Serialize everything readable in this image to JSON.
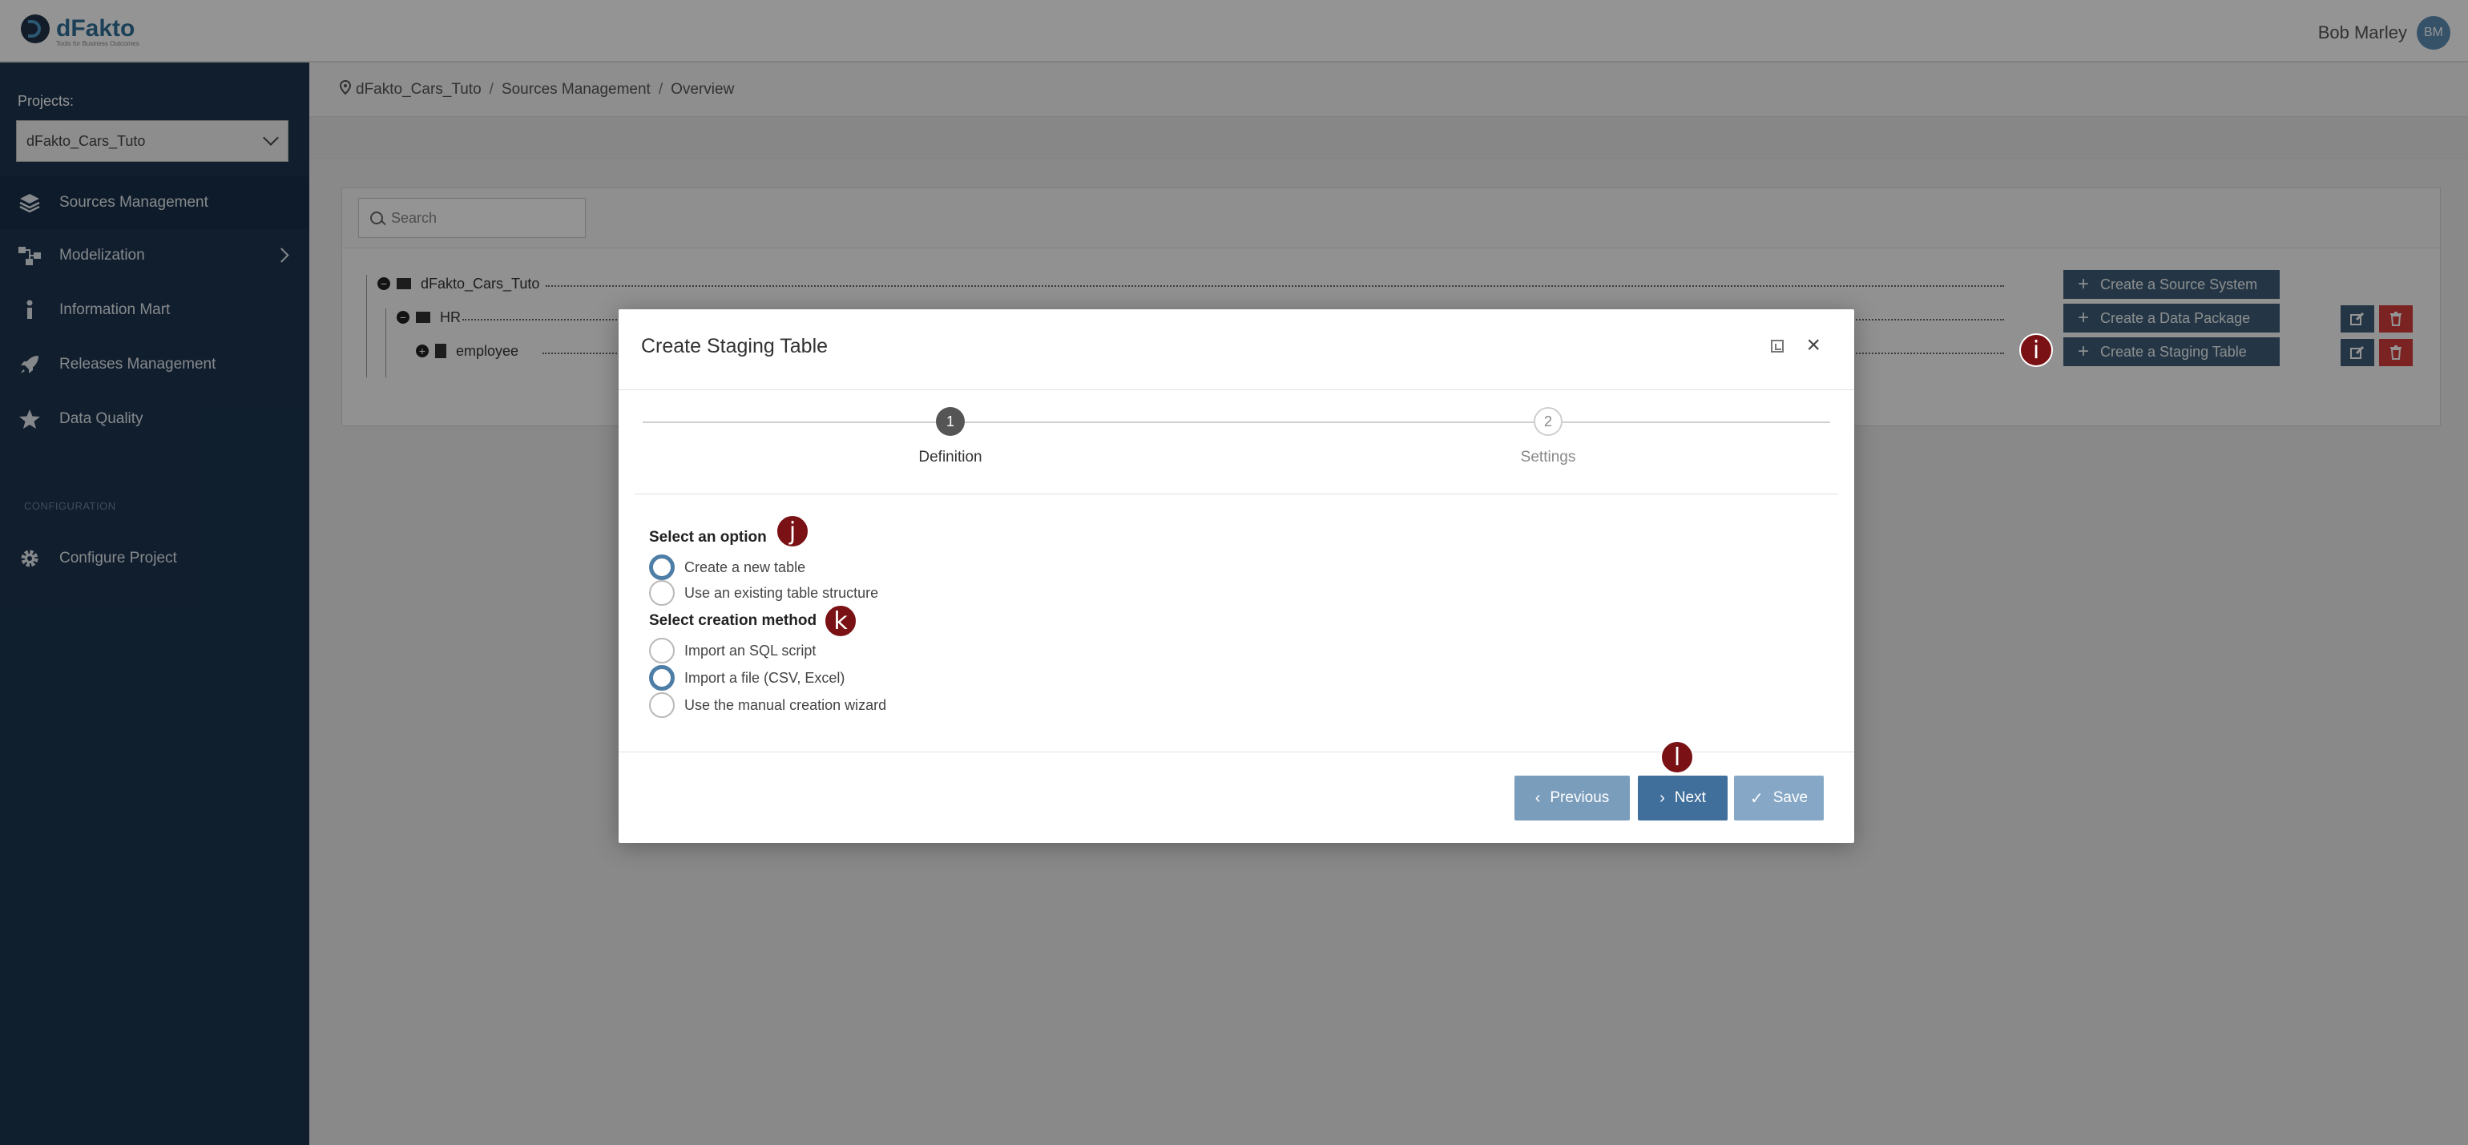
{
  "header": {
    "logo_text": "dFakto",
    "logo_tagline": "Tools for Business Outcomes",
    "user_name": "Bob Marley",
    "user_initials": "BM"
  },
  "sidebar": {
    "projects_label": "Projects:",
    "project_selected": "dFakto_Cars_Tuto",
    "items": [
      {
        "label": "Sources Management",
        "icon": "layers-icon"
      },
      {
        "label": "Modelization",
        "icon": "hierarchy-icon"
      },
      {
        "label": "Information Mart",
        "icon": "info-icon"
      },
      {
        "label": "Releases Management",
        "icon": "rocket-icon"
      },
      {
        "label": "Data Quality",
        "icon": "star-icon"
      }
    ],
    "section_label": "CONFIGURATION",
    "config_item": {
      "label": "Configure Project",
      "icon": "gear-icon"
    }
  },
  "breadcrumb": [
    "dFakto_Cars_Tuto",
    "Sources Management",
    "Overview"
  ],
  "search": {
    "placeholder": "Search"
  },
  "tree": [
    {
      "label": "dFakto_Cars_Tuto",
      "toggle": "−"
    },
    {
      "label": "HR",
      "toggle": "−"
    },
    {
      "label": "employee",
      "toggle": "+"
    }
  ],
  "actions": {
    "create_source_system": "Create a Source System",
    "create_data_package": "Create a Data Package",
    "create_staging_table": "Create a Staging Table"
  },
  "modal": {
    "title": "Create Staging Table",
    "steps": [
      {
        "number": "1",
        "label": "Definition"
      },
      {
        "number": "2",
        "label": "Settings"
      }
    ],
    "option_label": "Select an option",
    "options": [
      "Create a new table",
      "Use an existing table structure"
    ],
    "method_label": "Select creation method",
    "methods": [
      "Import an SQL script",
      "Import a file (CSV, Excel)",
      "Use the manual creation wizard"
    ],
    "buttons": {
      "previous": "Previous",
      "next": "Next",
      "save": "Save"
    }
  },
  "markers": {
    "i": "i",
    "j": "j",
    "k": "k",
    "l": "l"
  },
  "colors": {
    "sidebar_bg": "#1c3550",
    "primary_button": "#3f6f9a",
    "delete_button": "#d43b3b",
    "marker": "#7a1114"
  }
}
